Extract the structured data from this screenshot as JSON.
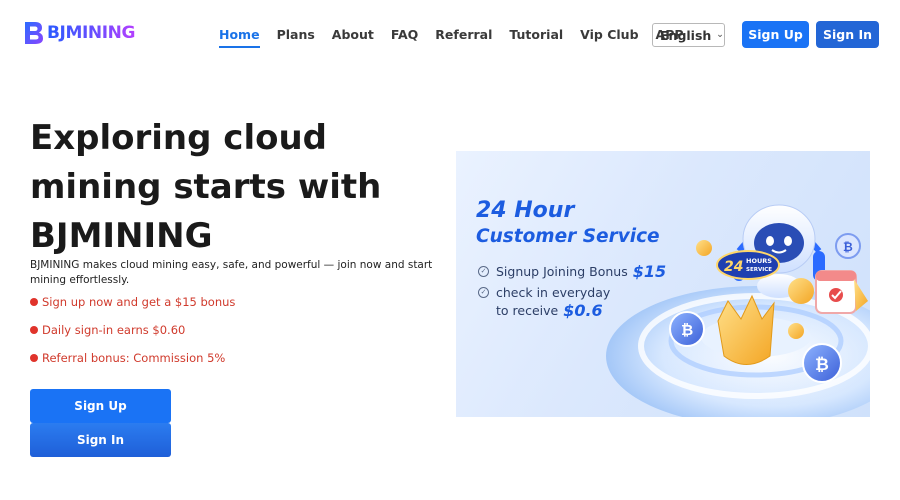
{
  "header": {
    "brand": "BJMINING",
    "nav": [
      {
        "label": "Home",
        "active": true
      },
      {
        "label": "Plans",
        "active": false
      },
      {
        "label": "About",
        "active": false
      },
      {
        "label": "FAQ",
        "active": false
      },
      {
        "label": "Referral",
        "active": false
      },
      {
        "label": "Tutorial",
        "active": false
      },
      {
        "label": "Vip Club",
        "active": false
      },
      {
        "label": "APP",
        "active": false
      }
    ],
    "language": "English",
    "signup_label": "Sign Up",
    "signin_label": "Sign In"
  },
  "hero": {
    "title": "Exploring cloud mining starts with BJMINING",
    "description": "BJMINING makes cloud mining easy, safe, and powerful — join now and start mining effortlessly.",
    "bullets": [
      "Sign up now and get a $15 bonus",
      "Daily sign-in earns $0.60",
      "Referral bonus: Commission 5%"
    ],
    "signup_label": "Sign Up",
    "signin_label": "Sign In"
  },
  "banner": {
    "heading_line1": "24 Hour",
    "heading_line2": "Customer Service",
    "item1_text": "Signup Joining Bonus",
    "item1_amount": "$15",
    "item2_text_line1": "check in everyday",
    "item2_text_line2": "to receive",
    "item2_amount": "$0.6",
    "badge_number": "24",
    "badge_line1": "HOURS",
    "badge_line2": "SERVICE"
  },
  "colors": {
    "accent": "#1a73f5",
    "bullet_red": "#d03a2c",
    "banner_blue": "#1c5ce0"
  }
}
